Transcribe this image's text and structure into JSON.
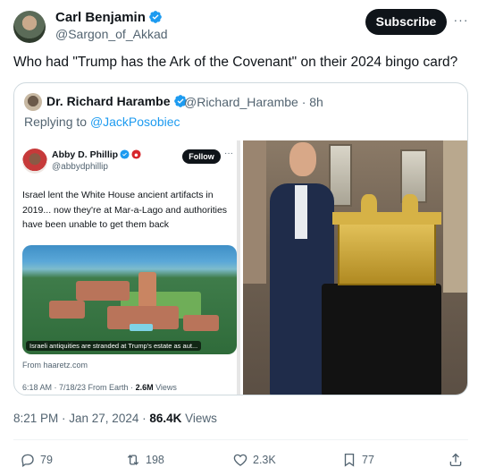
{
  "author": {
    "name": "Carl Benjamin",
    "handle": "@Sargon_of_Akkad",
    "verified_color": "#1d9bf0"
  },
  "header": {
    "subscribe_label": "Subscribe",
    "more_label": "···"
  },
  "tweet_text": "Who had \"Trump has the Ark of the Covenant\" on their 2024 bingo card?",
  "quote": {
    "name": "Dr. Richard Harambe",
    "handle_time": "@Richard_Harambe · 8h",
    "reply_prefix": "Replying to ",
    "reply_mention": "@JackPosobiec",
    "embed": {
      "name": "Abby D. Phillip",
      "handle": "@abbydphillip",
      "follow_label": "Follow",
      "more_label": "···",
      "text": "Israel lent the White House ancient artifacts in 2019... now they're at Mar-a-Lago and authorities have been unable to get them back",
      "photo_caption": "Israeli antiquities are stranded at Trump's estate as aut...",
      "source": "From haaretz.com",
      "meta_prefix": "6:18 AM · 7/18/23 From Earth · ",
      "meta_views": "2.6M",
      "meta_views_label": " Views"
    }
  },
  "timestamp": {
    "time": "8:21 PM · Jan 27, 2024 · ",
    "views": "86.4K",
    "views_label": " Views"
  },
  "actions": {
    "replies": "79",
    "reposts": "198",
    "likes": "2.3K",
    "bookmarks": "77"
  },
  "colors": {
    "text_primary": "#0f1419",
    "text_secondary": "#536471",
    "accent": "#1d9bf0",
    "border": "#cfd9de"
  }
}
